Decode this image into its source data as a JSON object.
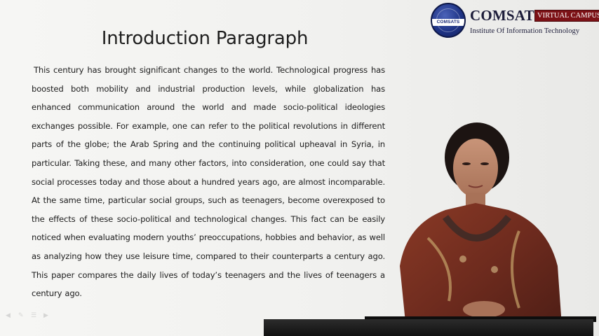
{
  "logo": {
    "emblem_text": "COMSATS",
    "name": "COMSATS",
    "badge": "VIRTUAL CAMPUS",
    "subtitle": "Institute Of Information Technology"
  },
  "slide": {
    "title": "Introduction Paragraph",
    "paragraph": "This century has brought significant changes to the world. Technological progress has boosted both mobility and industrial production levels, while globalization has enhanced communication around the world and made socio-political ideologies exchanges possible. For example, one can refer to the political revolutions in different parts of the globe; the Arab Spring and the continuing political upheaval in Syria, in particular. Taking these, and many other factors, into consideration, one could say that social processes today and those about a hundred years ago, are almost incomparable. At the same time, particular social groups, such as teenagers, become overexposed to the effects of these socio-political and technological changes. This fact can be easily noticed when evaluating modern youths’ preoccupations, hobbies and behavior, as well as analyzing how they use leisure time, compared to their counterparts a century ago. This paper compares the daily lives of today’s teenagers and the lives of teenagers a century ago."
  },
  "colors": {
    "background": "#f4f4f2",
    "logo_blue": "#1f3486",
    "badge_red": "#7c1116",
    "text": "#202020"
  },
  "presenter": {
    "icon": "presenter-video"
  }
}
